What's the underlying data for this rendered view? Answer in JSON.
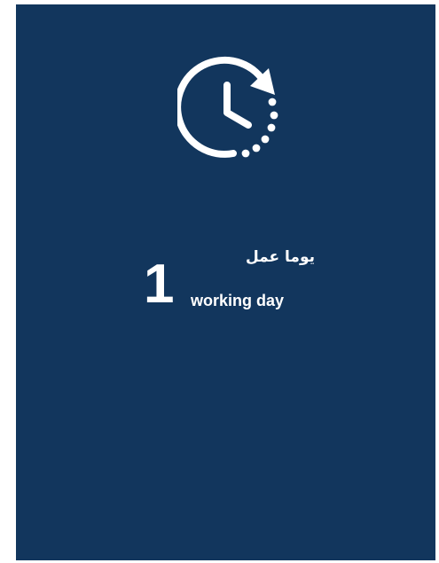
{
  "card": {
    "background": "#12365d",
    "icon": "clock-with-rotation-arrow-icon",
    "value": "1",
    "label_ar": "يوما عمل",
    "label_en": "working day"
  }
}
